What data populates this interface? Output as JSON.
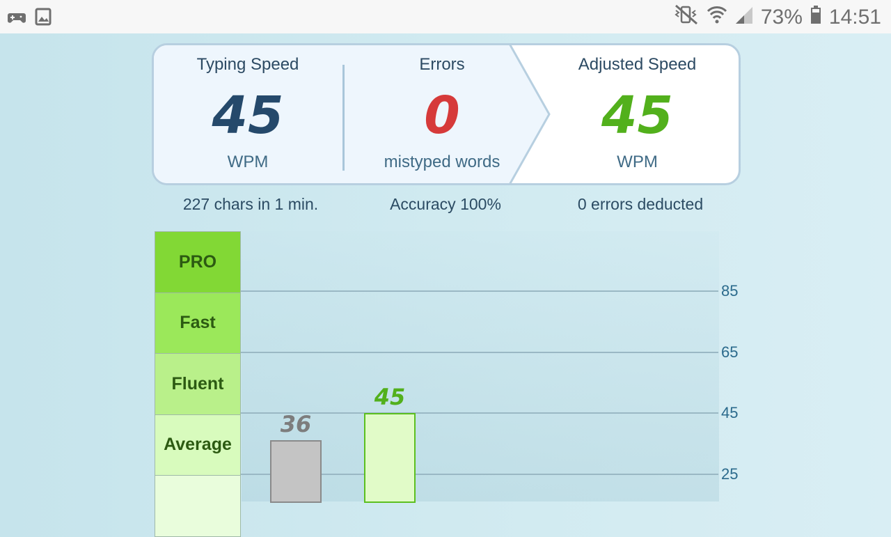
{
  "statusbar": {
    "left_icons": [
      "game-controller-icon",
      "image-icon"
    ],
    "right_icons": [
      "mute-vibrate-icon",
      "wifi-icon",
      "signal-icon",
      "battery-icon"
    ],
    "battery": "73%",
    "time": "14:51"
  },
  "summary": {
    "typing_speed": {
      "label": "Typing Speed",
      "value": "45",
      "unit": "WPM"
    },
    "errors": {
      "label": "Errors",
      "value": "0",
      "unit": "mistyped words"
    },
    "adjusted_speed": {
      "label": "Adjusted Speed",
      "value": "45",
      "unit": "WPM"
    }
  },
  "info": {
    "chars": "227 chars in 1 min.",
    "accuracy": "Accuracy 100%",
    "deducted": "0 errors deducted"
  },
  "colors": {
    "typing": "#25496b",
    "errors": "#d63a3a",
    "adjusted": "#52b01c",
    "previous_bar": "#c4c4c4",
    "current_bar": "#e1fbc8"
  },
  "chart_data": {
    "type": "bar",
    "levels": [
      {
        "name": "PRO",
        "color": "#82d835"
      },
      {
        "name": "Fast",
        "color": "#9be85a"
      },
      {
        "name": "Fluent",
        "color": "#b9f08a"
      },
      {
        "name": "Average",
        "color": "#d8fbbd"
      },
      {
        "name": "",
        "color": "#e9fddc"
      }
    ],
    "y_ticks": [
      85,
      65,
      45,
      25
    ],
    "bars": [
      {
        "value": 36,
        "label": "36",
        "kind": "previous"
      },
      {
        "value": 45,
        "label": "45",
        "kind": "current"
      }
    ]
  }
}
